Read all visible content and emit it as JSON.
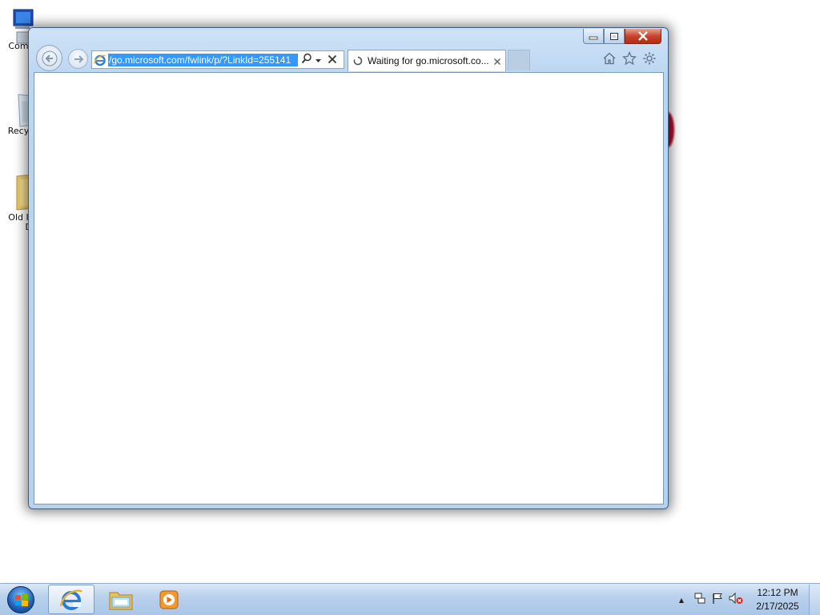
{
  "desktop": {
    "icons": [
      {
        "label": "Com"
      },
      {
        "label": "Recy"
      },
      {
        "label": "Old I",
        "label2": "D"
      }
    ]
  },
  "browser": {
    "address": {
      "url": "/go.microsoft.com/fwlink/p/?LinkId=255141"
    },
    "tab": {
      "title": "Waiting for go.microsoft.co...",
      "close_glyph": "×"
    }
  },
  "taskbar": {
    "clock": {
      "time": "12:12 PM",
      "date": "2/17/2025"
    },
    "tray_expand_glyph": "▲"
  },
  "colors": {
    "selection": "#3399ff",
    "window_frame": "#bcd6f1",
    "taskbar": "#b9d1ec",
    "close_button": "#c8442c"
  }
}
